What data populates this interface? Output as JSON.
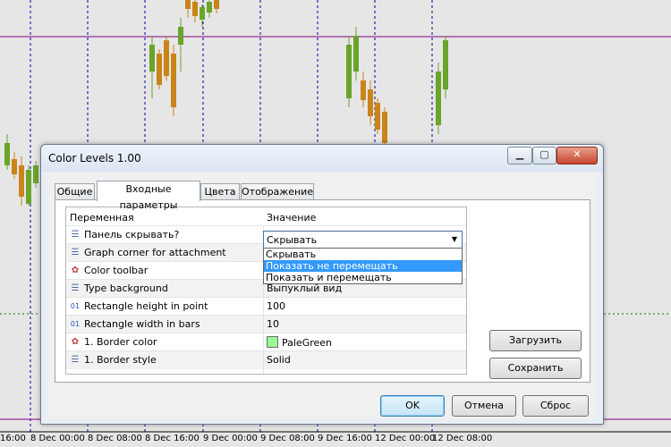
{
  "window": {
    "title": "Color Levels 1.00"
  },
  "window_controls": {
    "minimize": "▁",
    "maximize": "▢",
    "close": "✕"
  },
  "tabs": [
    {
      "label": "Общие"
    },
    {
      "label": "Входные параметры"
    },
    {
      "label": "Цвета"
    },
    {
      "label": "Отображение"
    }
  ],
  "grid": {
    "headers": {
      "variable": "Переменная",
      "value": "Значение"
    },
    "rows": [
      {
        "icon": "enum-icon",
        "name": "Панель скрывать?",
        "value": "Скрывать"
      },
      {
        "icon": "enum-icon",
        "name": "Graph corner for attachment",
        "value": ""
      },
      {
        "icon": "palette-icon",
        "name": "Color toolbar",
        "value": ""
      },
      {
        "icon": "enum-icon",
        "name": "Type background",
        "value": "Выпуклый вид"
      },
      {
        "icon": "int-icon",
        "name": "Rectangle height in point",
        "value": "100"
      },
      {
        "icon": "int-icon",
        "name": "Rectangle width in bars",
        "value": "10"
      },
      {
        "icon": "palette-icon",
        "name": "1. Border color",
        "value": "PaleGreen"
      },
      {
        "icon": "enum-icon",
        "name": "1. Border style",
        "value": "Solid"
      }
    ]
  },
  "dropdown": {
    "selected": "Скрывать",
    "options": [
      {
        "label": "Скрывать"
      },
      {
        "label": "Показать не перемещать",
        "highlighted": true
      },
      {
        "label": "Показать и перемещать"
      }
    ]
  },
  "buttons": {
    "load": "Загрузить",
    "save": "Сохранить",
    "ok": "OK",
    "cancel": "Отмена",
    "reset": "Сброс"
  },
  "chart": {
    "time_labels": [
      "16:00",
      "8 Dec 00:00",
      "8 Dec 08:00",
      "8 Dec 16:00",
      "9 Dec 00:00",
      "9 Dec 08:00",
      "9 Dec 16:00",
      "12 Dec 00:00",
      "12 Dec 08:00"
    ],
    "colors": {
      "bull": "#6aa42a",
      "bear": "#c9841a",
      "hline": "#800080",
      "vline": "#0000a0"
    }
  },
  "colors": {
    "swatch_palegreen": "#98fb98",
    "selection": "#3399ff"
  }
}
